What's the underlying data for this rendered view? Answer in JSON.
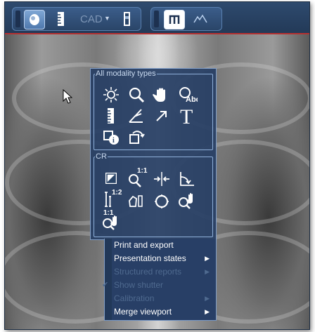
{
  "toolbar": {
    "cad_label": "CAD",
    "cad_dropdown_icon": "caret-down-icon",
    "buttons": [
      "patient-head-icon",
      "ruler-icon",
      "cad-icon",
      "window-level-icon",
      "layout-icon",
      "histogram-icon"
    ]
  },
  "context_menu": {
    "group1": {
      "title": "All modality types",
      "tools": [
        "brightness-icon",
        "zoom-icon",
        "pan-hand-icon",
        "magnifier-text-icon",
        "ruler-icon",
        "angle-icon",
        "arrow-icon",
        "text-annotation-icon",
        "image-info-icon",
        "rotate-icon"
      ]
    },
    "group2": {
      "title": "CR",
      "tools": [
        "invert-icon",
        "zoom-1to1-icon",
        "calibrate-icon",
        "right-angle-icon",
        "ratio-measure-icon",
        "polygon-icon",
        "circle-icon",
        "zoom-pan-icon",
        "zoom-1to1-pan-icon"
      ],
      "zoom_label": "1:1",
      "ratio_label": "1:2"
    },
    "items": [
      {
        "label": "Print and export",
        "enabled": true,
        "submenu": false,
        "checked": false
      },
      {
        "label": "Presentation states",
        "enabled": true,
        "submenu": true,
        "checked": false
      },
      {
        "label": "Structured reports",
        "enabled": false,
        "submenu": true,
        "checked": false
      },
      {
        "label": "Show shutter",
        "enabled": false,
        "submenu": false,
        "checked": true
      },
      {
        "label": "Calibration",
        "enabled": false,
        "submenu": true,
        "checked": false
      },
      {
        "label": "Merge viewport",
        "enabled": true,
        "submenu": true,
        "checked": false
      }
    ],
    "submenu_arrow": "▶",
    "check_mark": "✔"
  }
}
